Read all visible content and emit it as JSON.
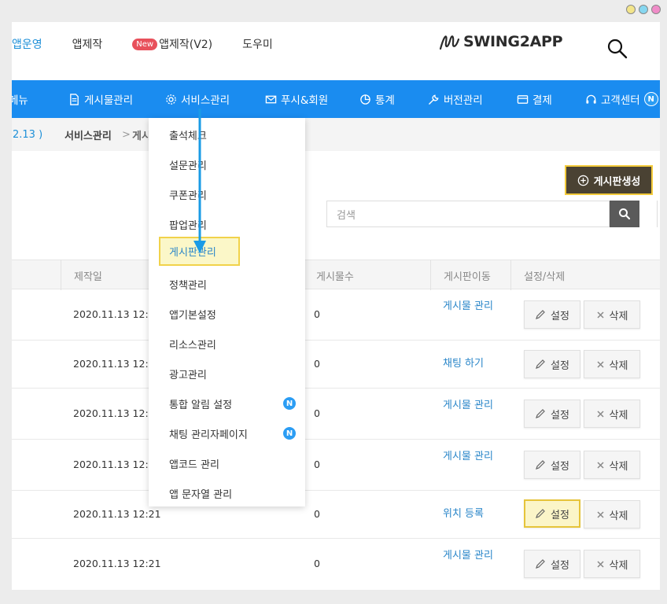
{
  "window": {
    "dot_colors": [
      "#f3e58a",
      "#86d7f0",
      "#f08cc8"
    ]
  },
  "top_nav": {
    "items": [
      {
        "label": "앱운영",
        "active": true
      },
      {
        "label": "앱제작"
      },
      {
        "badge": "New",
        "label": "앱제작(V2)"
      },
      {
        "label": "도우미"
      }
    ],
    "logo": "SWING2APP"
  },
  "main_menu": {
    "items": [
      "메뉴",
      "게시물관리",
      "서비스관리",
      "푸시&회원",
      "통계",
      "버전관리",
      "결제",
      "고객센터"
    ],
    "badge": "N"
  },
  "breadcrumb": {
    "version": "2.13 )",
    "level1": "서비스관리",
    "separator": ">",
    "level2": "게시"
  },
  "actions": {
    "create_label": "게시판생성",
    "search_placeholder": "검색"
  },
  "table": {
    "headers": [
      "제작일",
      "게시물수",
      "게시판이동",
      "설정/삭제"
    ],
    "rows": [
      {
        "date": "2020.11.13 12:21",
        "count": "0",
        "link": "게시물 관리"
      },
      {
        "date": "2020.11.13 12:21",
        "count": "0",
        "link": "채팅 하기"
      },
      {
        "date": "2020.11.13 12:21",
        "count": "0",
        "link": "게시물 관리"
      },
      {
        "date": "2020.11.13 12:21",
        "count": "0",
        "link": "게시물 관리"
      },
      {
        "date": "2020.11.13 12:21",
        "count": "0",
        "link": "위치 등록"
      },
      {
        "date": "2020.11.13 12:21",
        "count": "0",
        "link": "게시물 관리"
      }
    ],
    "set_label": "설정",
    "delete_label": "삭제"
  },
  "dropdown": {
    "items": [
      {
        "label": "출석체크"
      },
      {
        "label": "설문관리"
      },
      {
        "label": "쿠폰관리"
      },
      {
        "label": "팝업관리"
      },
      {
        "label": "게시판관리",
        "highlight": true
      },
      {
        "label": "정책관리"
      },
      {
        "label": "앱기본설정"
      },
      {
        "label": "리소스관리"
      },
      {
        "label": "광고관리"
      },
      {
        "label": "통합 알림 설정",
        "badge": "N"
      },
      {
        "label": "채팅 관리자페이지",
        "badge": "N"
      },
      {
        "label": "앱코드 관리"
      },
      {
        "label": "앱 문자열 관리"
      }
    ]
  },
  "colors": {
    "primary": "#1a8cf0",
    "link": "#2a86c9",
    "highlight_border": "#f1d24a",
    "highlight_bg": "#fbf7c8",
    "new_badge": "#e8505b"
  }
}
